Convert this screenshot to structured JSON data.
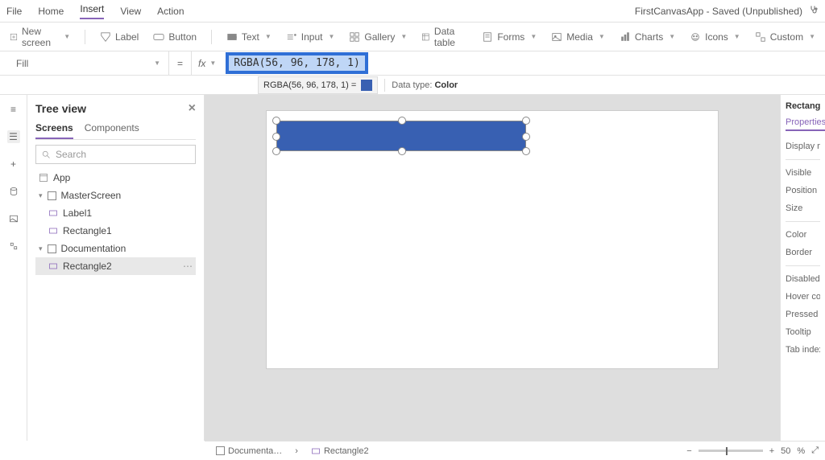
{
  "app_title": "FirstCanvasApp - Saved (Unpublished)",
  "menu": {
    "file": "File",
    "home": "Home",
    "insert": "Insert",
    "view": "View",
    "action": "Action"
  },
  "toolbar": {
    "new_screen": "New screen",
    "label": "Label",
    "button": "Button",
    "text": "Text",
    "input": "Input",
    "gallery": "Gallery",
    "data_table": "Data table",
    "forms": "Forms",
    "media": "Media",
    "charts": "Charts",
    "icons": "Icons",
    "custom": "Custom"
  },
  "formula": {
    "property": "Fill",
    "fx_label": "fx",
    "expression": "RGBA(56, 96, 178, 1)",
    "result_text": "RGBA(56, 96, 178, 1)  =",
    "data_type_label": "Data type:",
    "data_type_value": "Color"
  },
  "tree": {
    "title": "Tree view",
    "tabs": {
      "screens": "Screens",
      "components": "Components"
    },
    "search_placeholder": "Search",
    "nodes": {
      "app": "App",
      "master": "MasterScreen",
      "label1": "Label1",
      "rect1": "Rectangle1",
      "doc": "Documentation",
      "rect2": "Rectangle2"
    }
  },
  "right": {
    "title": "Rectangle",
    "properties": "Properties",
    "display_mode": "Display mo",
    "visible": "Visible",
    "position": "Position",
    "size": "Size",
    "color": "Color",
    "border": "Border",
    "disabled": "Disabled co",
    "hover": "Hover color",
    "pressed": "Pressed col",
    "tooltip": "Tooltip",
    "tab_index": "Tab index"
  },
  "breadcrumb": {
    "item1": "Documenta…",
    "item2": "Rectangle2"
  },
  "zoom": {
    "value": "50",
    "pct": "%"
  }
}
